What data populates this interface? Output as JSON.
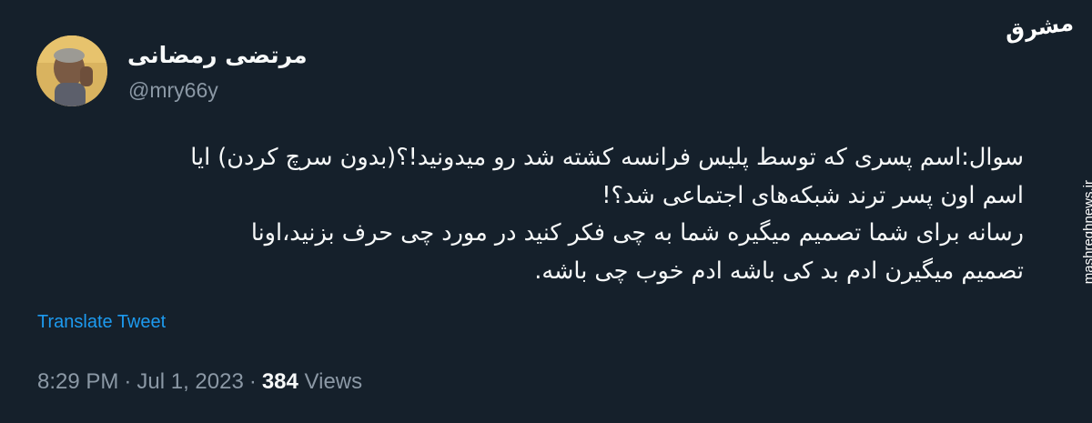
{
  "tweet": {
    "author_name": "مرتضی رمضانی",
    "handle": "@mry66y",
    "body_lines": [
      "سوال:اسم پسری که توسط پلیس فرانسه کشته شد رو میدونید!؟(بدون سرچ کردن) ایا",
      "اسم اون پسر ترند شبکه‌های اجتماعی شد؟!",
      "رسانه برای شما تصمیم میگیره شما به چی فکر کنید در مورد چی حرف بزنید،اونا",
      "تصمیم میگیرن ادم بد کی باشه ادم خوب چی باشه."
    ],
    "translate_label": "Translate Tweet",
    "time": "8:29 PM",
    "date": "Jul 1, 2023",
    "separator": "·",
    "views_count": "384",
    "views_label": "Views"
  },
  "watermark": {
    "logo": "مشرق",
    "site": "mashreghnews.ir"
  },
  "colors": {
    "background": "#15202b",
    "primary_text": "#f7f9f9",
    "secondary_text": "#8b98a5",
    "link": "#1d9bf0"
  },
  "icons": {
    "avatar": "avatar-photo"
  }
}
